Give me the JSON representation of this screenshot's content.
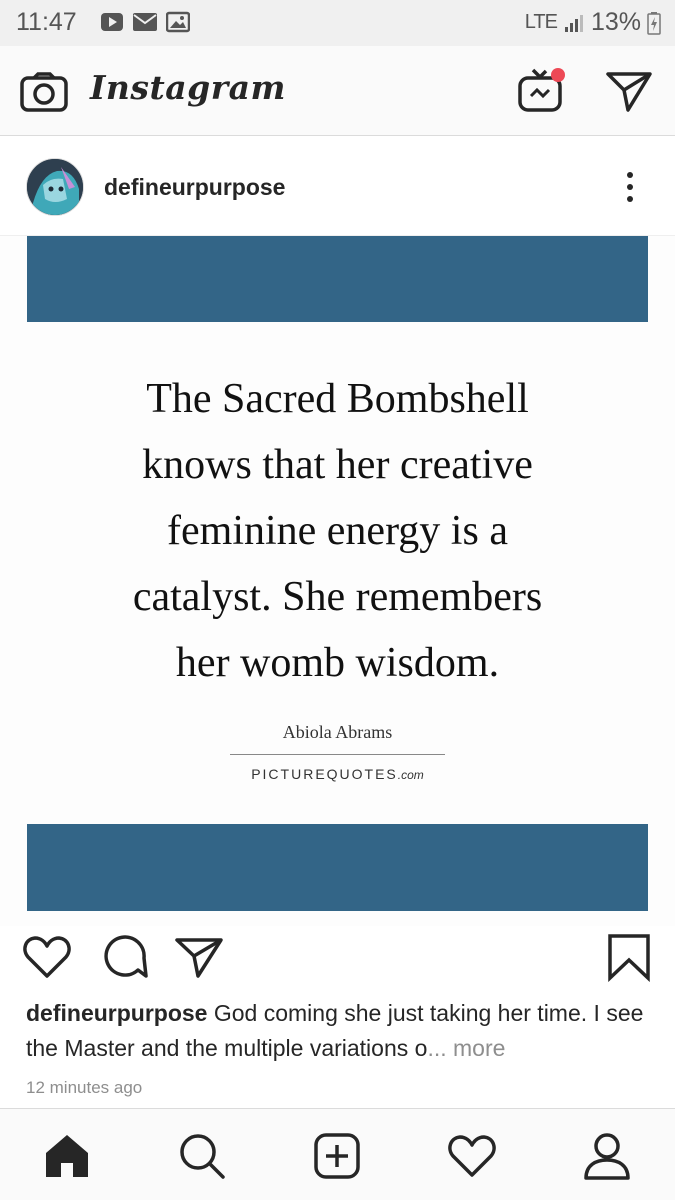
{
  "status_bar": {
    "time": "11:47",
    "network": "LTE",
    "battery": "13%"
  },
  "header": {
    "logo_text": "Instagram",
    "icons": [
      "camera-icon",
      "igtv-icon",
      "direct-message-icon"
    ],
    "notification_dot_color": "#ed4956"
  },
  "post": {
    "username": "defineurpurpose",
    "image": {
      "band_color": "#336587",
      "quote_lines": [
        "The Sacred Bombshell",
        "knows that her creative",
        "feminine energy is a",
        "catalyst. She remembers",
        "her womb wisdom."
      ],
      "author": "Abiola Abrams",
      "source_main": "PICTUREQUOTES",
      "source_suffix": ".com"
    },
    "caption_user": "defineurpurpose",
    "caption_text": " God coming she just taking her time. I see the Master and the multiple variations o",
    "caption_ellipsis": "... ",
    "more_label": "more",
    "timestamp": "12 minutes ago"
  },
  "bottom_nav": {
    "items": [
      "home-icon",
      "search-icon",
      "add-post-icon",
      "activity-heart-icon",
      "profile-icon"
    ]
  }
}
